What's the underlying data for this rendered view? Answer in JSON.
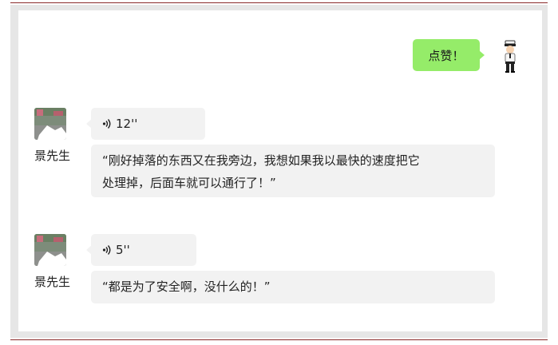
{
  "outgoing": {
    "text": "点赞！"
  },
  "messages": [
    {
      "sender": "景先生",
      "voice_duration": "12''",
      "quote_line1": "“刚好掉落的东西又在我旁边，我想如果我以最快的速度把它",
      "quote_line2": "处理掉，后面车就可以通行了！”"
    },
    {
      "sender": "景先生",
      "voice_duration": "5''",
      "quote_line1": "“都是为了安全啊，没什么的！”"
    }
  ],
  "colors": {
    "outgoing_bubble": "#95ec69",
    "incoming_bubble": "#f2f2f2",
    "frame": "#e6e6e6",
    "rule": "#8a2a2a"
  },
  "icons": {
    "voice": "voice-wave-icon",
    "police": "police-officer-avatar"
  }
}
